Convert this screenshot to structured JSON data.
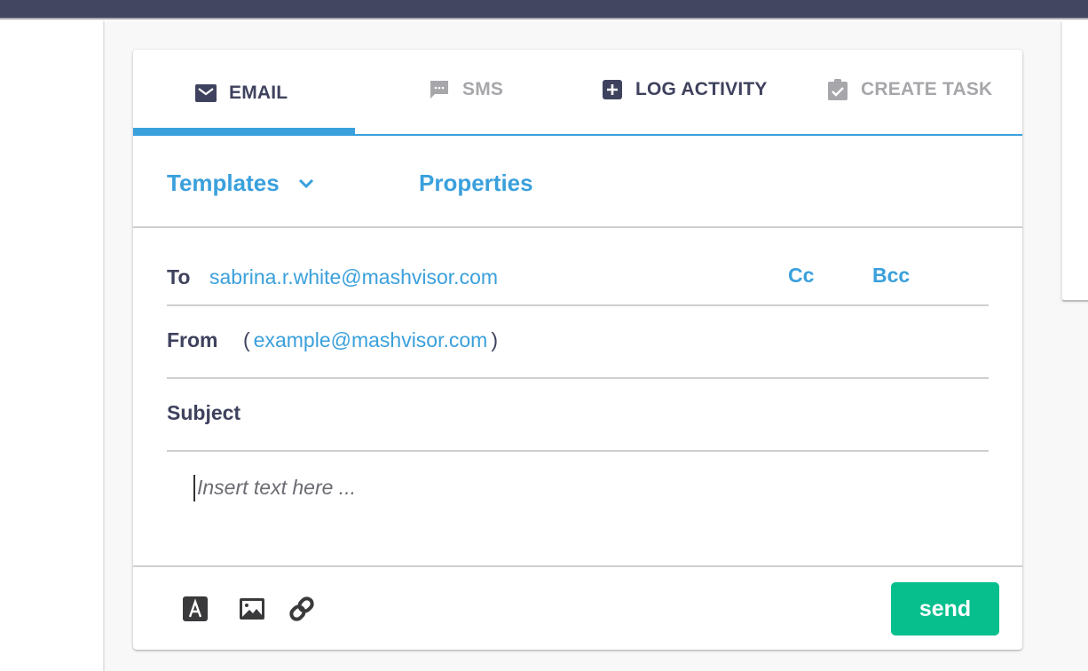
{
  "tabs": [
    {
      "label": "EMAIL",
      "icon": "envelope-icon",
      "active": true
    },
    {
      "label": "SMS",
      "icon": "chat-icon",
      "active": false
    },
    {
      "label": "LOG ACTIVITY",
      "icon": "plus-square-icon",
      "active": false
    },
    {
      "label": "CREATE TASK",
      "icon": "clipboard-check-icon",
      "active": false
    }
  ],
  "toolbar": {
    "templates_label": "Templates",
    "properties_label": "Properties"
  },
  "fields": {
    "to_label": "To",
    "to_value": "sabrina.r.white@mashvisor.com",
    "cc_label": "Cc",
    "bcc_label": "Bcc",
    "from_label": "From",
    "from_value": "example@mashvisor.com",
    "subject_label": "Subject"
  },
  "body": {
    "placeholder": "Insert text here ..."
  },
  "footer": {
    "icons": [
      "text-format-icon",
      "image-icon",
      "link-icon"
    ],
    "send_label": "send"
  },
  "colors": {
    "accent": "#3aa0dc",
    "primary_text": "#3f425e",
    "muted_text": "#a7a7ab",
    "send_button": "#07bf8d",
    "topbar": "#434661"
  }
}
